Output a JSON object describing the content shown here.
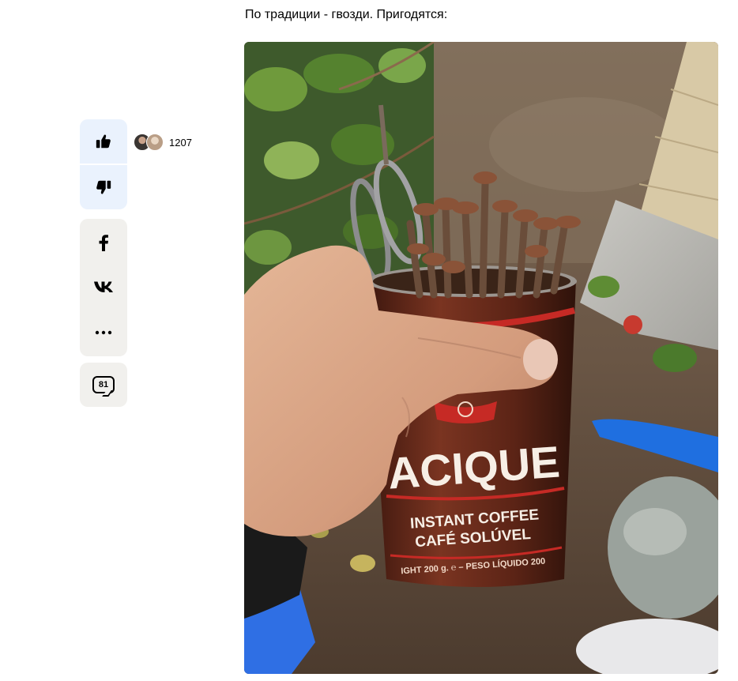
{
  "article": {
    "caption": "По традиции - гвозди. Пригодятся:"
  },
  "reactions": {
    "like_icon": "thumbs-up-icon",
    "dislike_icon": "thumbs-down-icon",
    "like_count": "1207"
  },
  "share": {
    "facebook_icon": "facebook-icon",
    "vk_icon": "vk-icon",
    "more_label": "..."
  },
  "comments": {
    "count": "81"
  },
  "photo": {
    "can_brand": "ACIQUE",
    "can_line1": "INSTANT COFFEE",
    "can_line2": "CAFÉ SOLÚVEL",
    "can_line3": "IGHT 200 g. ℮ – PESO LÍQUIDO 200"
  },
  "colors": {
    "like_bg": "#eaf2fd",
    "share_bg": "#f1f0ed",
    "can_brown": "#6a2d1d",
    "can_red": "#c62a25"
  }
}
